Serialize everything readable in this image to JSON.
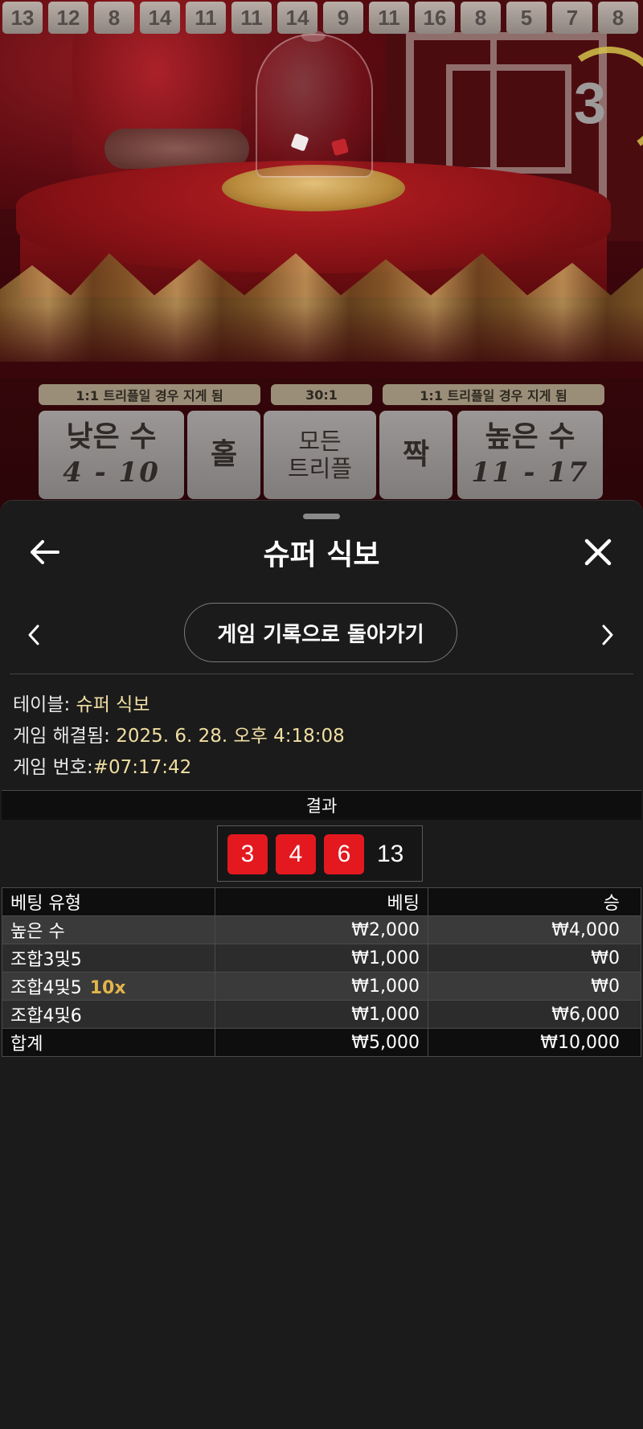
{
  "history": [
    "13",
    "12",
    "8",
    "14",
    "11",
    "11",
    "14",
    "9",
    "11",
    "16",
    "8",
    "5",
    "7",
    "8"
  ],
  "timer": "3",
  "board": {
    "left_tag": "1:1 트리플일 경우 지게 됨",
    "center_tag": "30:1",
    "right_tag": "1:1 트리플일 경우 지게 됨",
    "small_label": "낮은 수",
    "small_range": "4 - 10",
    "odd_label": "홀",
    "triple_line1": "모든",
    "triple_line2": "트리플",
    "even_label": "짝",
    "big_label": "높은 수",
    "big_range": "11 - 17"
  },
  "sheet": {
    "title": "슈퍼 식보",
    "return_button": "게임 기록으로 돌아가기",
    "table_label": "테이블:",
    "table_value": "슈퍼 식보",
    "resolved_label": "게임 해결됨:",
    "resolved_value": "2025. 6. 28. 오후 4:18:08",
    "game_no_label": "게임 번호:",
    "game_no_value": "#07:17:42",
    "result_header": "결과",
    "dice": [
      "3",
      "4",
      "6"
    ],
    "dice_total": "13",
    "dice_color": "#e3191f"
  },
  "bets": {
    "headers": [
      "베팅 유형",
      "베팅",
      "승"
    ],
    "rows": [
      {
        "type": "높은 수",
        "mult": "",
        "bet": "₩2,000",
        "win": "₩4,000"
      },
      {
        "type": "조합3및5",
        "mult": "",
        "bet": "₩1,000",
        "win": "₩0"
      },
      {
        "type": "조합4및5",
        "mult": "10x",
        "bet": "₩1,000",
        "win": "₩0"
      },
      {
        "type": "조합4및6",
        "mult": "",
        "bet": "₩1,000",
        "win": "₩6,000"
      }
    ],
    "total": {
      "label": "합계",
      "bet": "₩5,000",
      "win": "₩10,000"
    }
  },
  "icons": {
    "back": "arrow-left-icon",
    "close": "close-icon",
    "prev": "chevron-left-icon",
    "next": "chevron-right-icon"
  }
}
